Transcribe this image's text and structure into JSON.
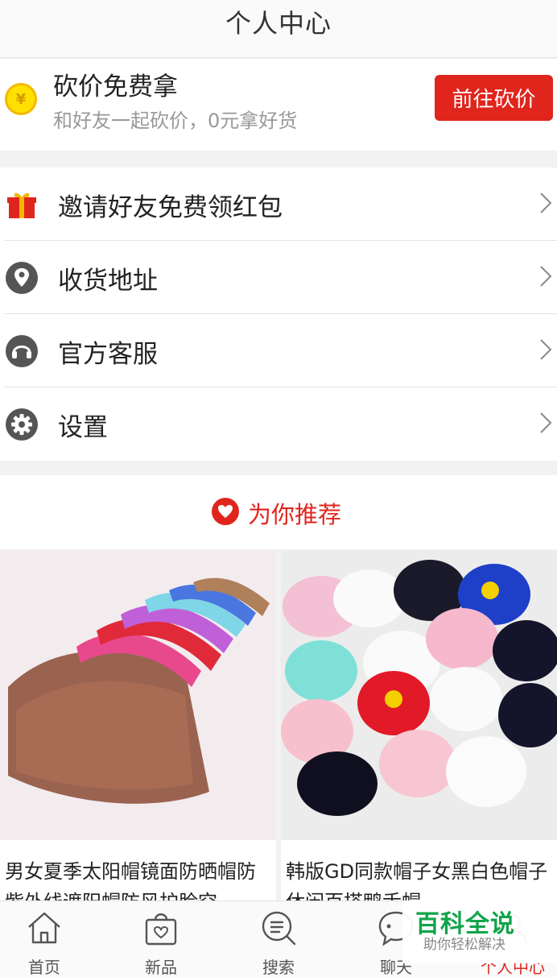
{
  "header": {
    "title": "个人中心"
  },
  "bargain": {
    "coin_symbol": "¥",
    "title": "砍价免费拿",
    "subtitle": "和好友一起砍价，0元拿好货",
    "button_label": "前往砍价"
  },
  "menu": [
    {
      "icon": "gift-icon",
      "label": "邀请好友免费领红包"
    },
    {
      "icon": "location-pin-icon",
      "label": "收货地址"
    },
    {
      "icon": "headset-icon",
      "label": "官方客服"
    },
    {
      "icon": "gear-icon",
      "label": "设置"
    }
  ],
  "recommend": {
    "icon": "heart-icon",
    "label": "为你推荐"
  },
  "products": [
    {
      "name": "男女夏季太阳帽镜面防晒帽防紫外线遮阳帽防风护脸空"
    },
    {
      "name": "韩版GD同款帽子女黑白色帽子休闲百搭鸭舌帽"
    }
  ],
  "tabbar": [
    {
      "icon": "home-icon",
      "label": "首页",
      "active": false
    },
    {
      "icon": "shopping-bag-icon",
      "label": "新品",
      "active": false
    },
    {
      "icon": "search-icon",
      "label": "搜索",
      "active": false
    },
    {
      "icon": "chat-icon",
      "label": "聊天",
      "active": false
    },
    {
      "icon": "user-icon",
      "label": "个人中心",
      "active": true
    }
  ],
  "watermark": {
    "main": "百科全说",
    "sub": "助你轻松解决"
  },
  "colors": {
    "accent": "#e0251d",
    "icon_gray": "#555555",
    "watermark_green": "#11a44a"
  }
}
